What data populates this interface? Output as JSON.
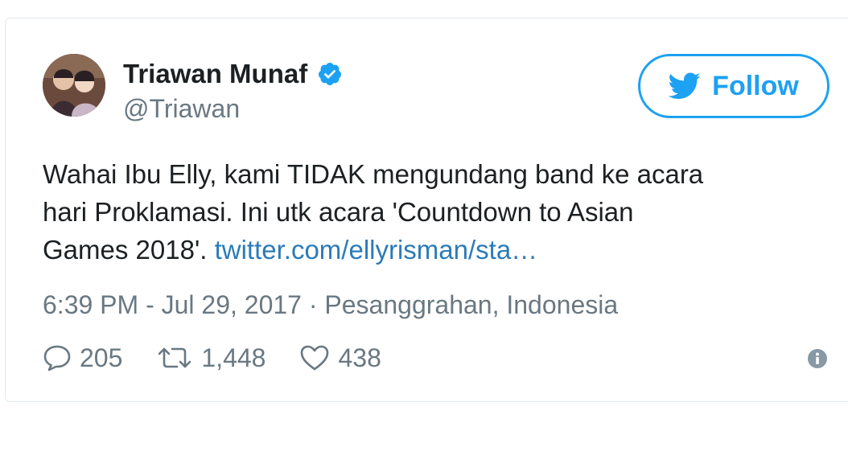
{
  "author": {
    "name": "Triawan Munaf",
    "handle": "@Triawan",
    "verified": true
  },
  "follow": {
    "label": "Follow",
    "icon": "twitter-bird-icon"
  },
  "tweet": {
    "text_lines": [
      "Wahai Ibu Elly, kami TIDAK mengundang band ke acara",
      "hari Proklamasi. Ini utk acara 'Countdown to Asian",
      "Games 2018'. "
    ],
    "link_text": "twitter.com/ellyrisman/sta…"
  },
  "meta": {
    "timestamp": "6:39 PM - Jul 29, 2017",
    "separator": " · ",
    "location": "Pesanggrahan, Indonesia"
  },
  "actions": {
    "replies": "205",
    "retweets": "1,448",
    "likes": "438"
  },
  "colors": {
    "twitter_blue": "#1da1f2",
    "link_blue": "#2b7bb9",
    "muted_gray": "#697882",
    "text_dark": "#1c2022"
  }
}
